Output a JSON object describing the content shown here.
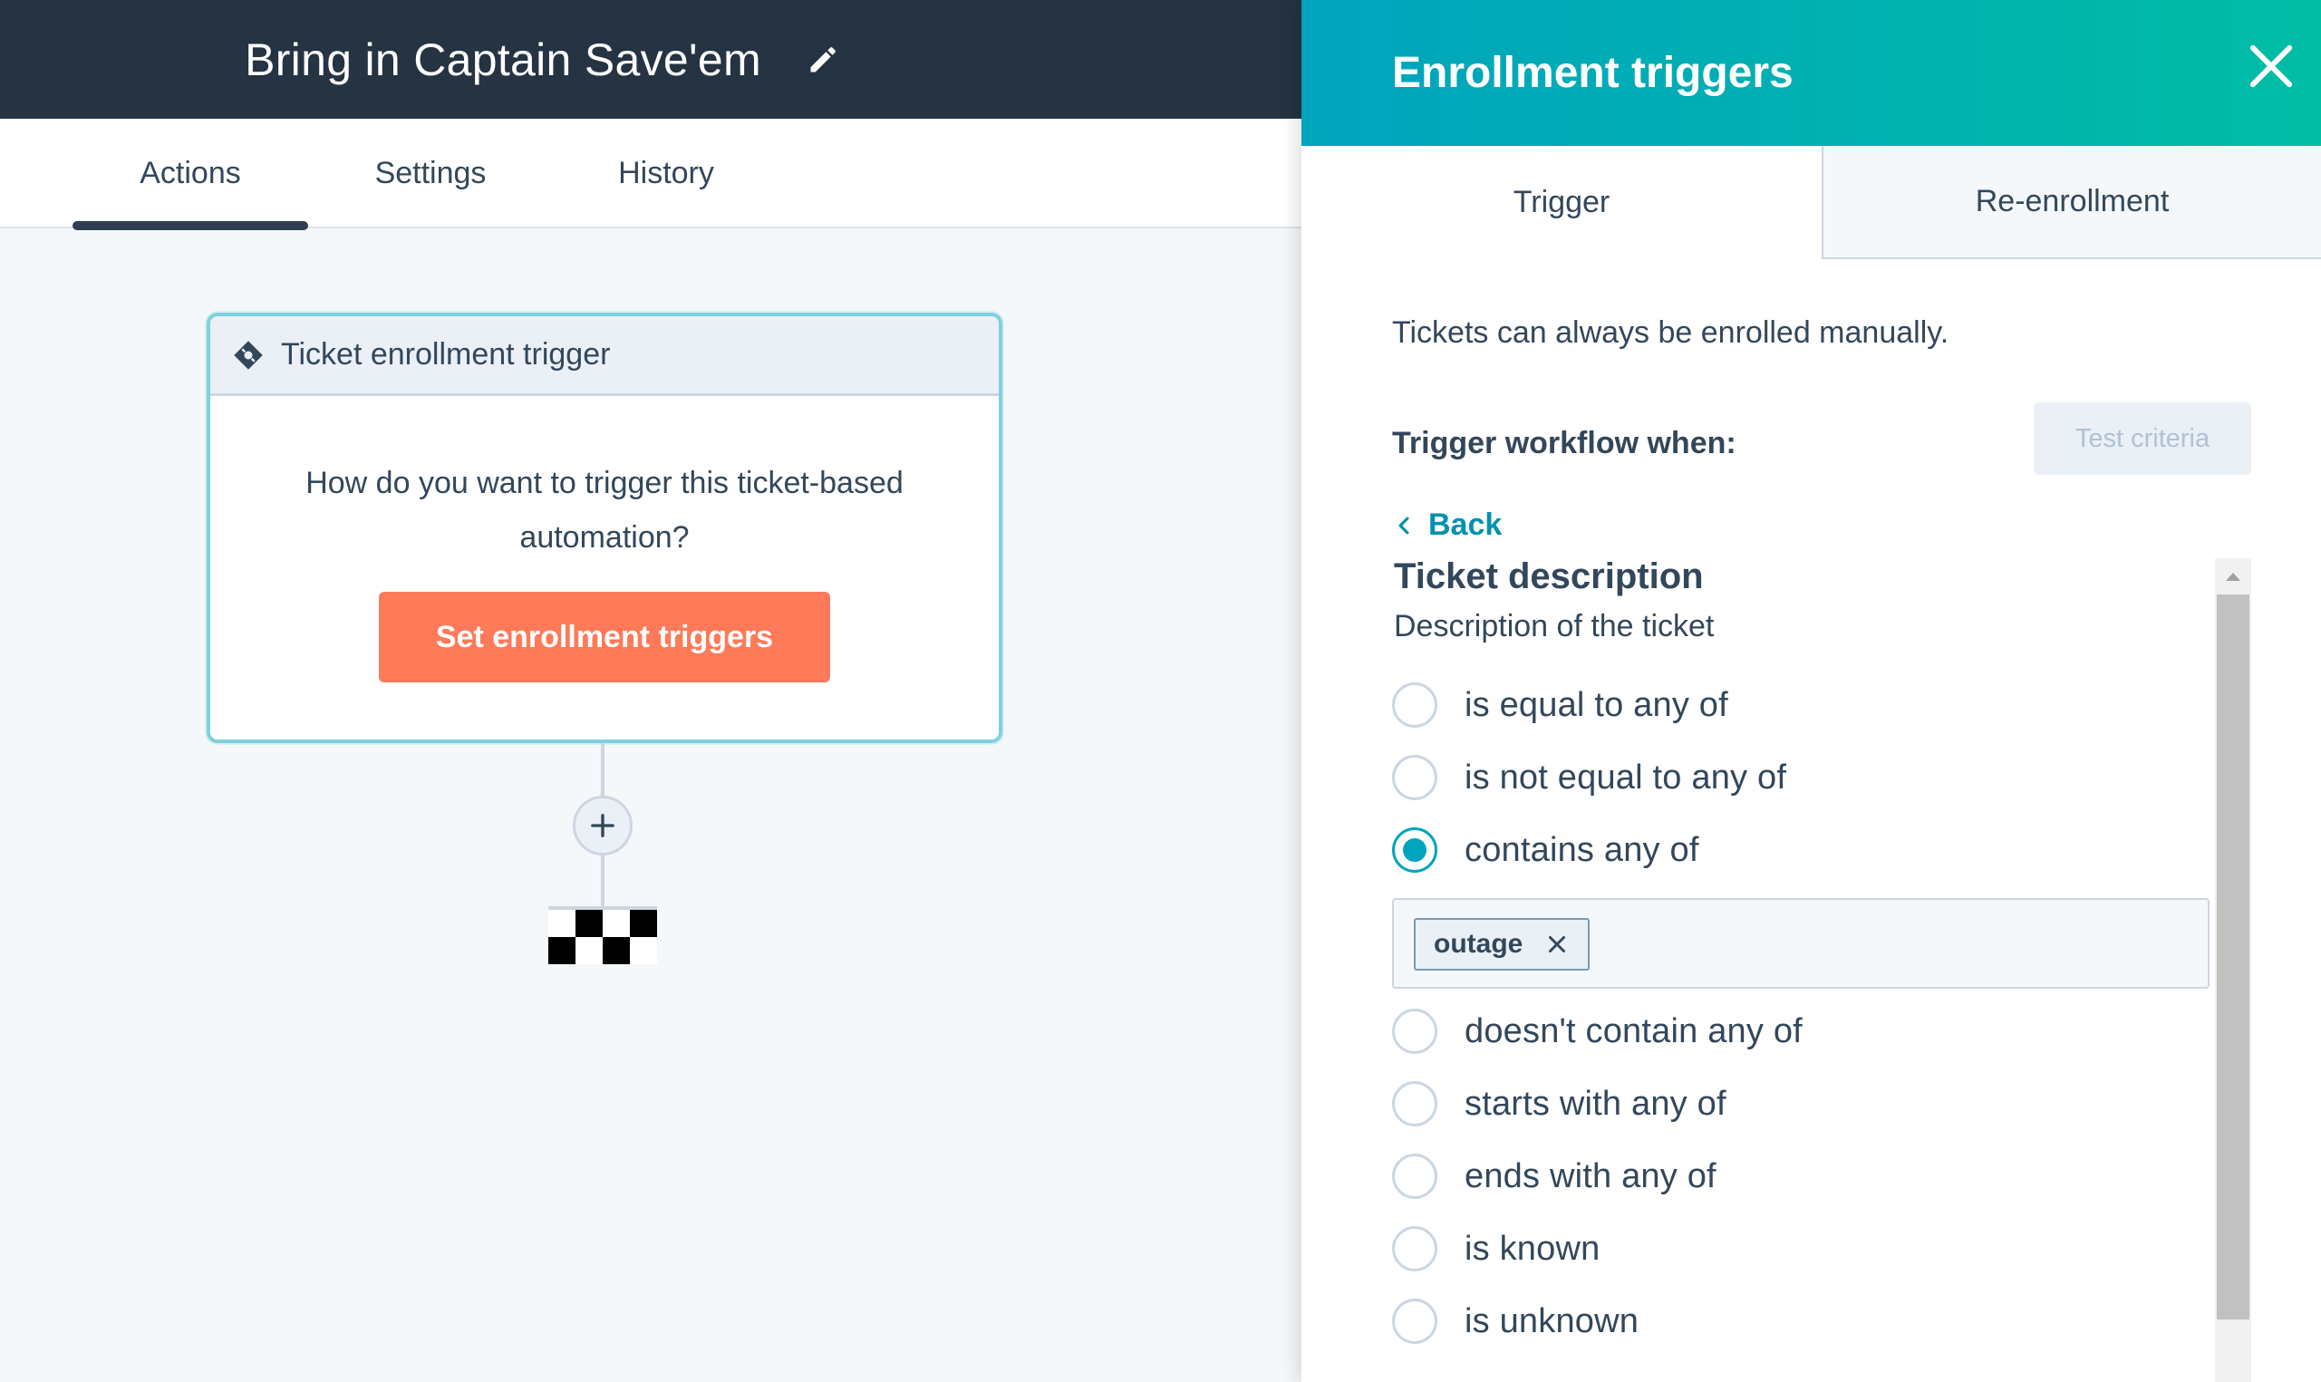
{
  "workflow": {
    "title": "Bring in Captain Save'em",
    "tabs": [
      {
        "label": "Actions",
        "active": true
      },
      {
        "label": "Settings",
        "active": false
      },
      {
        "label": "History",
        "active": false
      }
    ]
  },
  "trigger_card": {
    "header": "Ticket enrollment trigger",
    "question": "How do you want to trigger this ticket-based automation?",
    "button_label": "Set enrollment triggers"
  },
  "panel": {
    "title": "Enrollment triggers",
    "tabs": [
      {
        "label": "Trigger",
        "active": true
      },
      {
        "label": "Re-enrollment",
        "active": false
      }
    ],
    "note": "Tickets can always be enrolled manually.",
    "when_label": "Trigger workflow when:",
    "test_criteria_label": "Test criteria",
    "back_label": "Back",
    "property": {
      "title": "Ticket description",
      "description": "Description of the ticket"
    },
    "options": [
      {
        "label": "is equal to any of",
        "selected": false
      },
      {
        "label": "is not equal to any of",
        "selected": false
      },
      {
        "label": "contains any of",
        "selected": true
      },
      {
        "label": "doesn't contain any of",
        "selected": false
      },
      {
        "label": "starts with any of",
        "selected": false
      },
      {
        "label": "ends with any of",
        "selected": false
      },
      {
        "label": "is known",
        "selected": false
      },
      {
        "label": "is unknown",
        "selected": false
      }
    ],
    "selected_values": [
      "outage"
    ]
  },
  "colors": {
    "topbar": "#253342",
    "accent_teal": "#00a4bd",
    "accent_green": "#00bda5",
    "cta_orange": "#ff7a59",
    "link": "#0091ae"
  },
  "icons": [
    "edit-pencil-icon",
    "ticket-icon",
    "close-icon",
    "plus-icon",
    "chevron-left-icon",
    "remove-tag-icon",
    "scroll-up-arrow-icon"
  ]
}
